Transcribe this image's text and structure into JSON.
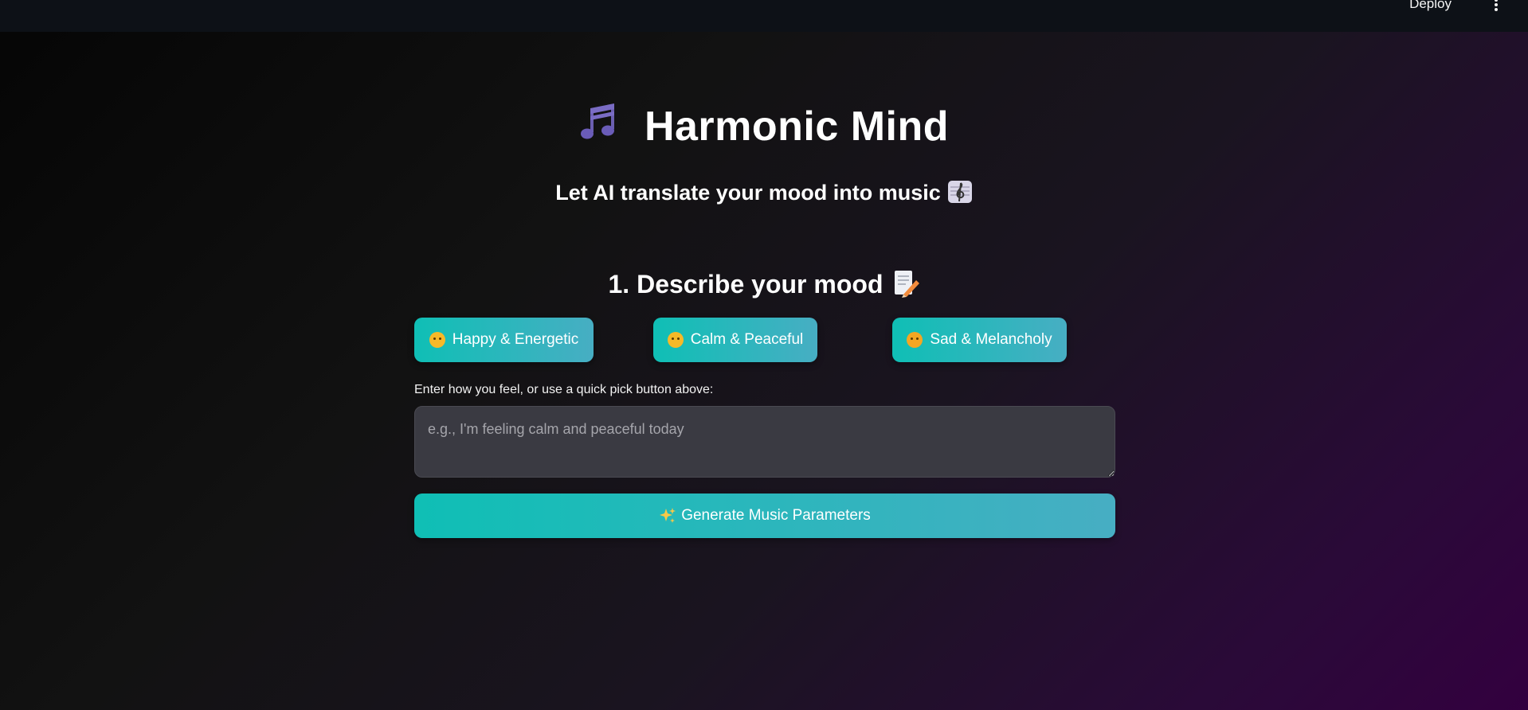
{
  "topbar": {
    "deploy_label": "Deploy",
    "menu_icon": "kebab-menu-icon"
  },
  "header": {
    "title": "Harmonic Mind",
    "title_icon": "musical-notes-icon",
    "subtitle": "Let AI translate your mood into music",
    "subtitle_icon": "treble-clef-icon"
  },
  "mood_section": {
    "heading": "1. Describe your mood",
    "heading_icon": "memo-icon",
    "quick_picks": [
      {
        "label": "Happy & Energetic",
        "icon": "smiling-face-icon"
      },
      {
        "label": "Calm & Peaceful",
        "icon": "relieved-face-icon"
      },
      {
        "label": "Sad & Melancholy",
        "icon": "pleading-face-icon"
      }
    ],
    "input_label": "Enter how you feel, or use a quick pick button above:",
    "input_placeholder": "e.g., I'm feeling calm and peaceful today",
    "input_value": "",
    "generate_label": "Generate Music Parameters",
    "generate_icon": "sparkles-icon"
  },
  "colors": {
    "accent_start": "#0fbfb5",
    "accent_end": "#47aec3",
    "topbar_bg": "#0d1117",
    "input_bg": "#3a3a42"
  }
}
